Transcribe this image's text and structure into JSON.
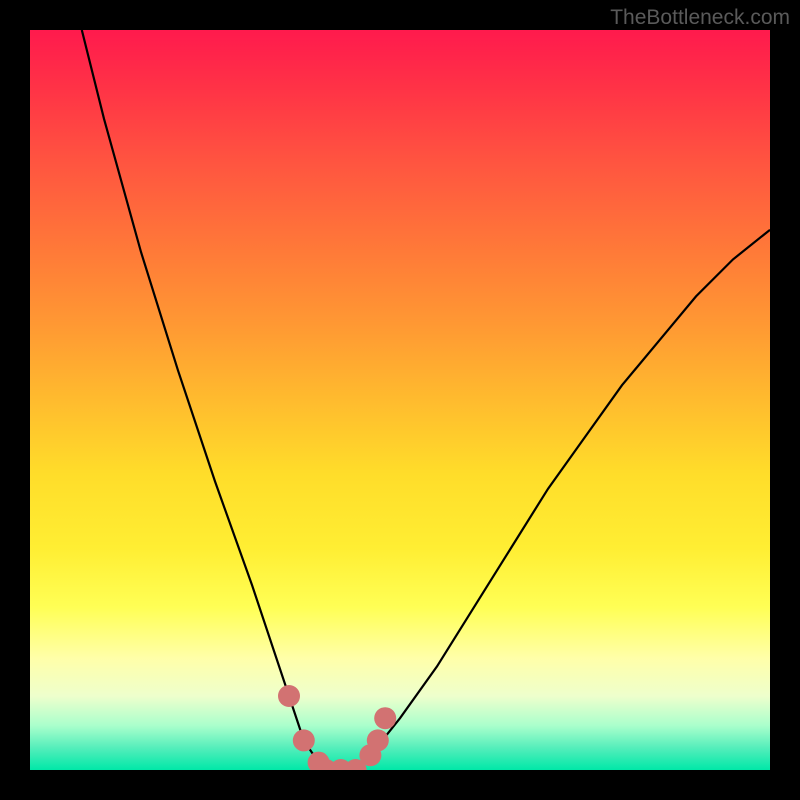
{
  "watermark": "TheBottleneck.com",
  "chart_data": {
    "type": "line",
    "title": "",
    "xlabel": "",
    "ylabel": "",
    "xlim": [
      0,
      100
    ],
    "ylim": [
      0,
      100
    ],
    "series": [
      {
        "name": "bottleneck-curve",
        "x": [
          7,
          10,
          15,
          20,
          25,
          30,
          33,
          35,
          37,
          39,
          40,
          42,
          44,
          46,
          50,
          55,
          60,
          65,
          70,
          75,
          80,
          85,
          90,
          95,
          100
        ],
        "values": [
          100,
          88,
          70,
          54,
          39,
          25,
          16,
          10,
          4,
          1,
          0,
          0,
          0,
          2,
          7,
          14,
          22,
          30,
          38,
          45,
          52,
          58,
          64,
          69,
          73
        ]
      },
      {
        "name": "data-points",
        "x": [
          35,
          37,
          39,
          40,
          42,
          44,
          46,
          47,
          48
        ],
        "values": [
          10,
          4,
          1,
          0,
          0,
          0,
          2,
          4,
          7
        ]
      }
    ],
    "colors": {
      "gradient_top": "#ff1a4d",
      "gradient_mid": "#ffee33",
      "gradient_bottom": "#00e8a8",
      "curve": "#000000",
      "points": "#d27272"
    }
  }
}
